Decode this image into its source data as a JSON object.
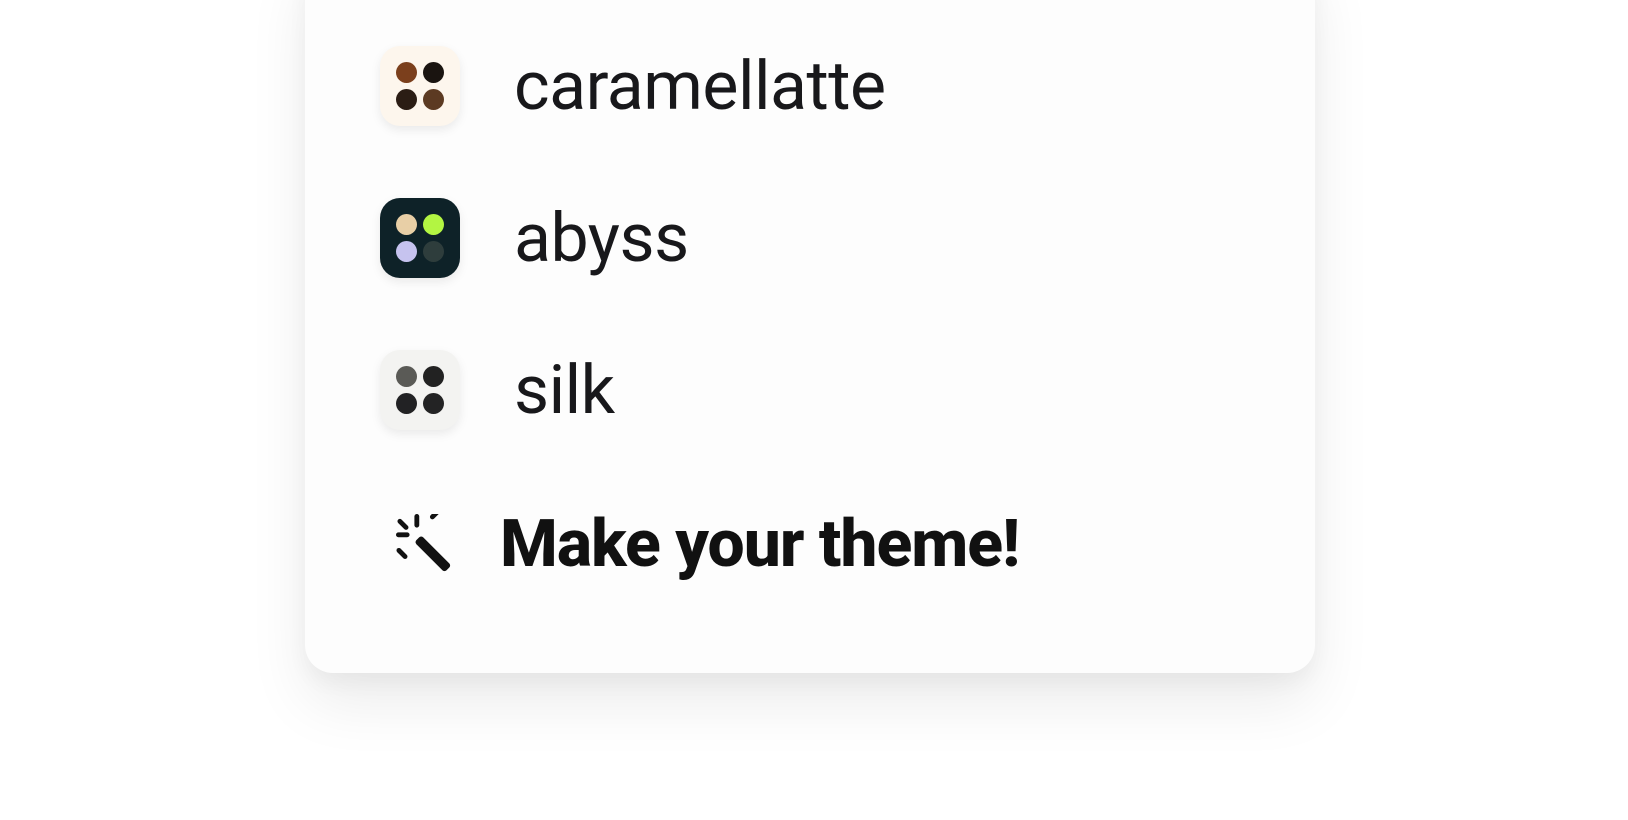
{
  "themes": [
    {
      "id": "caramellatte",
      "label": "caramellatte",
      "swatch_bg": "#fdf6ed",
      "colors": [
        "#7b3f1c",
        "#1a1410",
        "#2b1d14",
        "#5c3a22"
      ]
    },
    {
      "id": "abyss",
      "label": "abyss",
      "swatch_bg": "#0e2228",
      "colors": [
        "#e8cfa6",
        "#b3f542",
        "#c6c3ef",
        "#2e3d3c"
      ]
    },
    {
      "id": "silk",
      "label": "silk",
      "swatch_bg": "#f3f3f1",
      "colors": [
        "#5a5a56",
        "#222222",
        "#222224",
        "#232324"
      ]
    }
  ],
  "cta": {
    "label": "Make your theme!",
    "icon": "magic-wand-icon"
  }
}
